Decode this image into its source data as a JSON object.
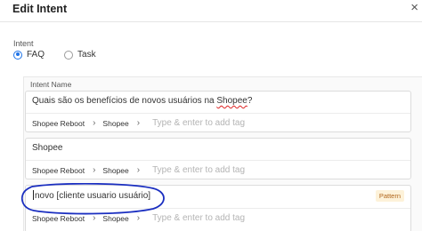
{
  "dialog": {
    "title": "Edit Intent",
    "close_glyph": "×"
  },
  "intent": {
    "label": "Intent",
    "options": [
      {
        "label": "FAQ",
        "selected": true
      },
      {
        "label": "Task",
        "selected": false
      }
    ]
  },
  "intent_name": {
    "label": "Intent Name",
    "cards": [
      {
        "text_before": "Quais são os benefícios de novos usuários na ",
        "text_flagged": "Shopee",
        "text_after": "?",
        "tags": [
          "Shopee Reboot",
          "Shopee"
        ],
        "tag_placeholder": "Type & enter to add tag"
      },
      {
        "text": "Shopee",
        "tags": [
          "Shopee Reboot",
          "Shopee"
        ],
        "tag_placeholder": "Type & enter to add tag"
      },
      {
        "text": "novo [cliente usuario usuário]",
        "badge": "Pattern",
        "tags": [
          "Shopee Reboot",
          "Shopee"
        ],
        "tag_placeholder": "Type & enter to add tag"
      }
    ]
  },
  "colors": {
    "accent": "#1e73e8",
    "annotation": "#1a2ec0",
    "badge_bg": "#fdf2d9",
    "badge_text": "#b0651c"
  },
  "icons": {
    "breadcrumb_separator": "chevron-right-icon",
    "close": "close-icon"
  }
}
